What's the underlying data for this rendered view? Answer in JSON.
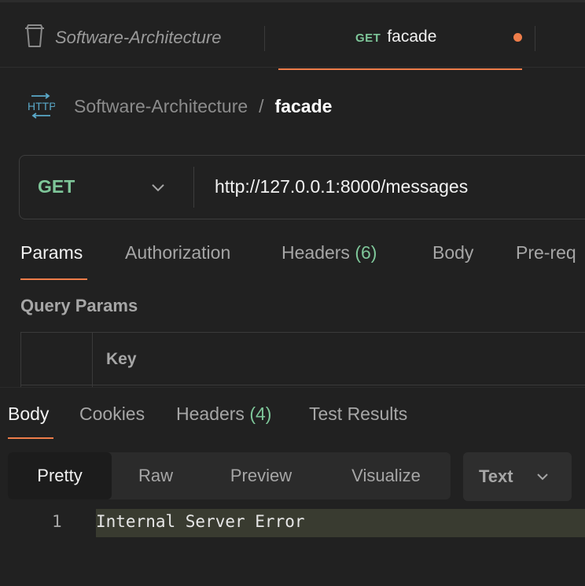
{
  "tabbar": {
    "collection_tab": {
      "label": "Software-Architecture",
      "icon": "trash-icon"
    },
    "active_tab": {
      "method": "GET",
      "name": "facade",
      "unsaved": true
    }
  },
  "breadcrumb": {
    "icon": "http-icon",
    "collection": "Software-Architecture",
    "separator": "/",
    "request": "facade"
  },
  "urlbar": {
    "method": "GET",
    "url": "http://127.0.0.1:8000/messages"
  },
  "request_tabs": {
    "params": "Params",
    "authorization": "Authorization",
    "headers_label": "Headers",
    "headers_count": "(6)",
    "body": "Body",
    "prerequest": "Pre-req"
  },
  "query_params": {
    "title": "Query Params",
    "key_header": "Key"
  },
  "response": {
    "tabs": {
      "body": "Body",
      "cookies": "Cookies",
      "headers_label": "Headers",
      "headers_count": "(4)",
      "test_results": "Test Results"
    },
    "views": {
      "pretty": "Pretty",
      "raw": "Raw",
      "preview": "Preview",
      "visualize": "Visualize"
    },
    "format": "Text",
    "lines": [
      {
        "number": "1",
        "text": "Internal Server Error"
      }
    ]
  },
  "colors": {
    "accent": "#ee7d4a",
    "method_get": "#7ec699",
    "background": "#212121"
  }
}
